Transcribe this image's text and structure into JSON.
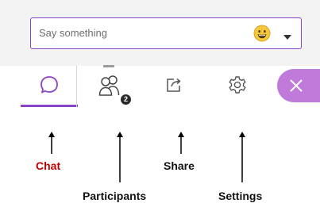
{
  "chat_input": {
    "placeholder": "Say something",
    "emoji_icon": "smiley-face-icon",
    "dropdown_icon": "caret-down-icon"
  },
  "toolbar": {
    "tabs": [
      {
        "id": "chat",
        "icon": "speech-bubble-icon",
        "selected": true
      },
      {
        "id": "participants",
        "icon": "people-icon",
        "badge": "2"
      },
      {
        "id": "share",
        "icon": "share-icon"
      },
      {
        "id": "settings",
        "icon": "gear-icon"
      }
    ],
    "close_icon": "close-icon"
  },
  "annotations": {
    "chat": "Chat",
    "participants": "Participants",
    "share": "Share",
    "settings": "Settings"
  },
  "colors": {
    "accent": "#8a43c9",
    "close_button": "#c07ad9",
    "chat_label": "#c00000",
    "label": "#111111"
  }
}
